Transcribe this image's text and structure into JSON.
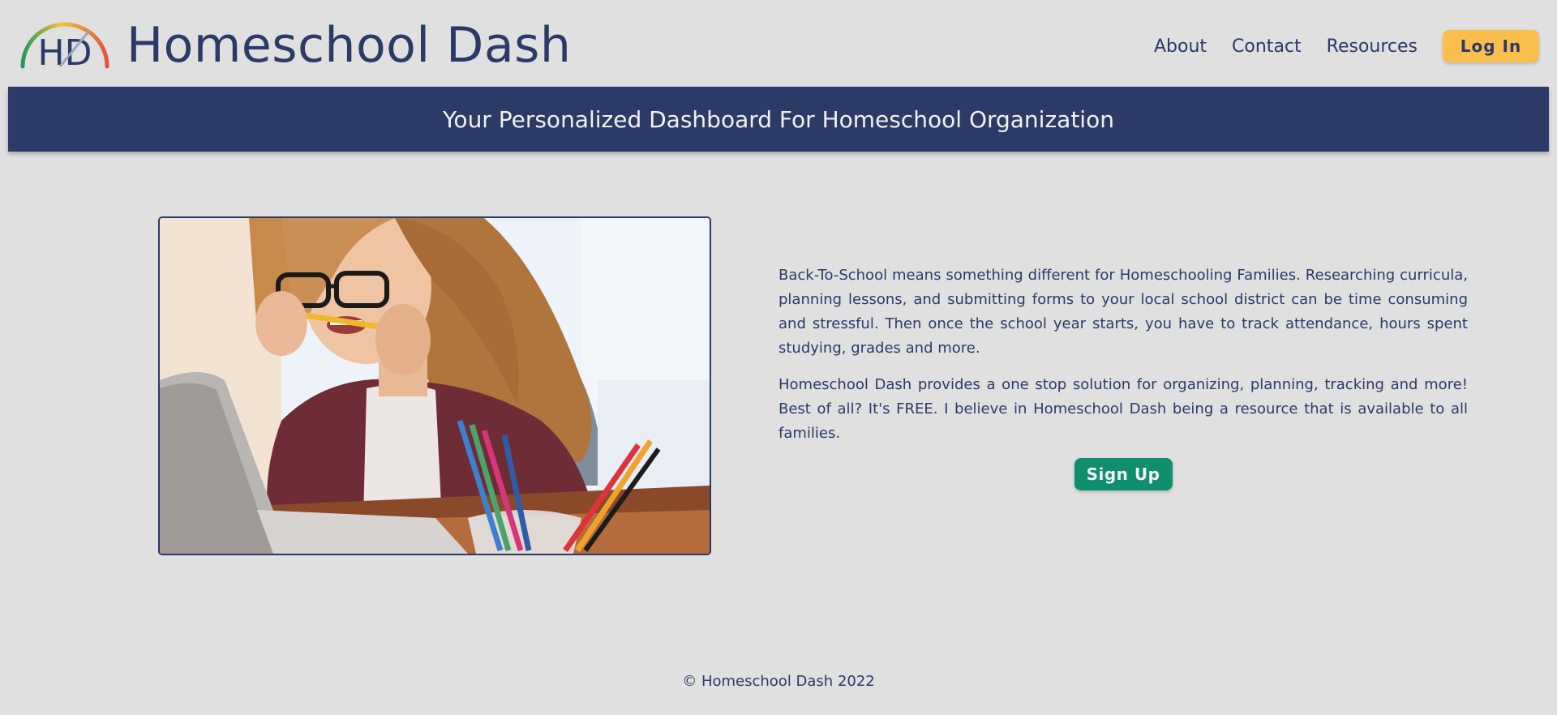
{
  "brand": {
    "logo_letters": "HD",
    "name": "Homeschool Dash"
  },
  "nav": {
    "links": [
      "About",
      "Contact",
      "Resources"
    ],
    "login_label": "Log In"
  },
  "banner": {
    "tagline": "Your Personalized Dashboard For Homeschool Organization"
  },
  "hero": {
    "image_icon": "photo-woman-biting-pencil-at-laptop"
  },
  "content": {
    "paragraph_1": "Back-To-School means something different for Homeschooling Families. Researching curricula, planning lessons, and submitting forms to your local school district can be time consuming and stressful. Then once the school year starts, you have to track attendance, hours spent studying, grades and more.",
    "paragraph_2": "Homeschool Dash provides a one stop solution for organizing, planning, tracking and more! Best of all? It's FREE. I believe in Homeschool Dash being a resource that is available to all families.",
    "signup_label": "Sign Up"
  },
  "footer": {
    "copyright": "© Homeschool Dash 2022"
  },
  "colors": {
    "background": "#e0e0e0",
    "navy": "#2b3a67",
    "login_yellow": "#f9be4b",
    "signup_green": "#0e8f6e"
  }
}
